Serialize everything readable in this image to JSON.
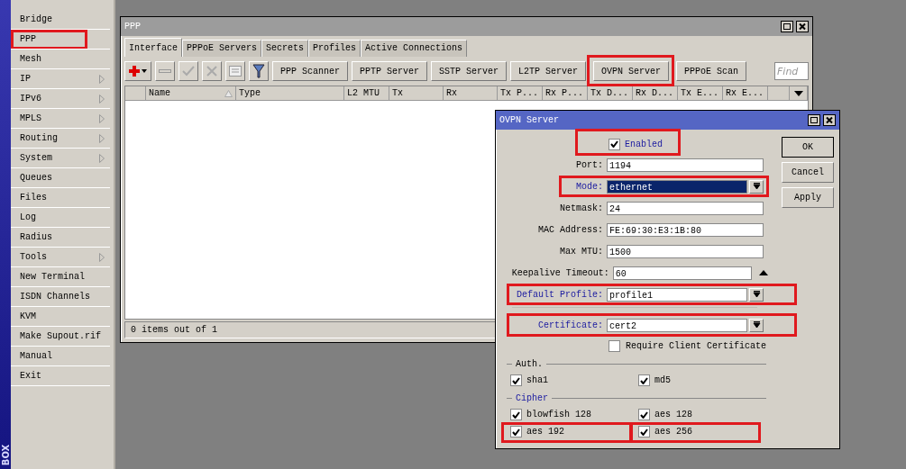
{
  "sidebar": {
    "items": [
      {
        "label": "Bridge",
        "submenu": false,
        "highlighted": false
      },
      {
        "label": "PPP",
        "submenu": false,
        "highlighted": true
      },
      {
        "label": "Mesh",
        "submenu": false,
        "highlighted": false
      },
      {
        "label": "IP",
        "submenu": true,
        "highlighted": false
      },
      {
        "label": "IPv6",
        "submenu": true,
        "highlighted": false
      },
      {
        "label": "MPLS",
        "submenu": true,
        "highlighted": false
      },
      {
        "label": "Routing",
        "submenu": true,
        "highlighted": false
      },
      {
        "label": "System",
        "submenu": true,
        "highlighted": false
      },
      {
        "label": "Queues",
        "submenu": false,
        "highlighted": false
      },
      {
        "label": "Files",
        "submenu": false,
        "highlighted": false
      },
      {
        "label": "Log",
        "submenu": false,
        "highlighted": false
      },
      {
        "label": "Radius",
        "submenu": false,
        "highlighted": false
      },
      {
        "label": "Tools",
        "submenu": true,
        "highlighted": false
      },
      {
        "label": "New Terminal",
        "submenu": false,
        "highlighted": false
      },
      {
        "label": "ISDN Channels",
        "submenu": false,
        "highlighted": false
      },
      {
        "label": "KVM",
        "submenu": false,
        "highlighted": false
      },
      {
        "label": "Make Supout.rif",
        "submenu": false,
        "highlighted": false
      },
      {
        "label": "Manual",
        "submenu": false,
        "highlighted": false
      },
      {
        "label": "Exit",
        "submenu": false,
        "highlighted": false
      }
    ],
    "brand": "BOX"
  },
  "ppp_window": {
    "title": "PPP",
    "tabs": [
      {
        "label": "Interface",
        "selected": true
      },
      {
        "label": "PPPoE Servers",
        "selected": false
      },
      {
        "label": "Secrets",
        "selected": false
      },
      {
        "label": "Profiles",
        "selected": false
      },
      {
        "label": "Active Connections",
        "selected": false
      }
    ],
    "icon_buttons": [
      {
        "kind": "add",
        "disabled": false
      },
      {
        "kind": "remove",
        "disabled": true
      },
      {
        "kind": "enable",
        "disabled": true
      },
      {
        "kind": "disable",
        "disabled": true
      },
      {
        "kind": "comment",
        "disabled": true
      },
      {
        "kind": "filter",
        "disabled": false
      }
    ],
    "buttons": [
      {
        "label": "PPP Scanner",
        "highlighted": false
      },
      {
        "label": "PPTP Server",
        "highlighted": false
      },
      {
        "label": "SSTP Server",
        "highlighted": false
      },
      {
        "label": "L2TP Server",
        "highlighted": false
      },
      {
        "label": "OVPN Server",
        "highlighted": true
      },
      {
        "label": "PPPoE Scan",
        "highlighted": false
      }
    ],
    "search": {
      "placeholder": "Find"
    },
    "table": {
      "columns": [
        {
          "label": "Name",
          "sorted": true
        },
        {
          "label": "Type",
          "sorted": false
        },
        {
          "label": "L2 MTU",
          "sorted": false
        },
        {
          "label": "Tx",
          "sorted": false
        },
        {
          "label": "Rx",
          "sorted": false
        },
        {
          "label": "Tx P...",
          "sorted": false
        },
        {
          "label": "Rx P...",
          "sorted": false
        },
        {
          "label": "Tx D...",
          "sorted": false
        },
        {
          "label": "Rx D...",
          "sorted": false
        },
        {
          "label": "Tx E...",
          "sorted": false
        },
        {
          "label": "Rx E...",
          "sorted": false
        }
      ]
    },
    "status_bar": "0 items out of 1"
  },
  "ovpn_dialog": {
    "title": "OVPN Server",
    "enabled": {
      "label": "Enabled",
      "checked": true,
      "highlighted": true
    },
    "fields": [
      {
        "label": "Port:",
        "value": "1194",
        "kind": "text",
        "accent": false,
        "focused": false,
        "highlighted": false
      },
      {
        "label": "Mode:",
        "value": "ethernet",
        "kind": "select",
        "accent": true,
        "focused": true,
        "highlighted": true
      },
      {
        "label": "Netmask:",
        "value": "24",
        "kind": "text",
        "accent": false,
        "focused": false,
        "highlighted": false
      },
      {
        "label": "MAC Address:",
        "value": "FE:69:30:E3:1B:80",
        "kind": "text",
        "accent": false,
        "focused": false,
        "highlighted": false
      },
      {
        "label": "Max MTU:",
        "value": "1500",
        "kind": "text",
        "accent": false,
        "focused": false,
        "highlighted": false
      },
      {
        "label": "Keepalive Timeout:",
        "value": "60",
        "kind": "spin",
        "accent": false,
        "focused": false,
        "highlighted": false
      },
      {
        "label": "Default Profile:",
        "value": "profile1",
        "kind": "select",
        "accent": true,
        "focused": false,
        "highlighted": true
      },
      {
        "label": "Certificate:",
        "value": "cert2",
        "kind": "select",
        "accent": true,
        "focused": false,
        "highlighted": true,
        "divider_before": true
      }
    ],
    "require_cert": {
      "label": "Require Client Certificate",
      "checked": false
    },
    "groups": [
      {
        "title": "Auth.",
        "accent": false,
        "options": [
          {
            "label": "sha1",
            "checked": true,
            "highlighted": false
          },
          {
            "label": "md5",
            "checked": true,
            "highlighted": false
          }
        ]
      },
      {
        "title": "Cipher",
        "accent": true,
        "options": [
          {
            "label": "blowfish 128",
            "checked": true,
            "highlighted": false
          },
          {
            "label": "aes 128",
            "checked": true,
            "highlighted": false
          },
          {
            "label": "aes 192",
            "checked": true,
            "highlighted": true
          },
          {
            "label": "aes 256",
            "checked": true,
            "highlighted": true
          }
        ]
      }
    ],
    "buttons": [
      "OK",
      "Cancel",
      "Apply"
    ]
  }
}
